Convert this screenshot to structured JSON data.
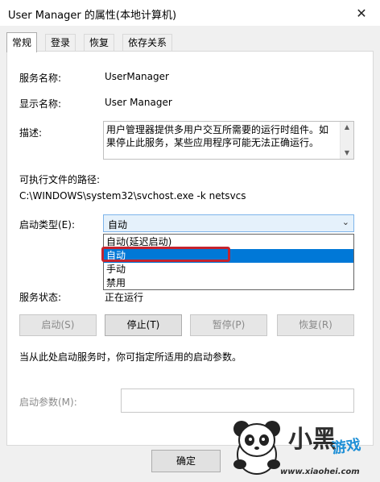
{
  "window": {
    "title": "User Manager 的属性(本地计算机)",
    "close_glyph": "✕"
  },
  "tabs": [
    {
      "label": "常规",
      "active": true
    },
    {
      "label": "登录",
      "active": false
    },
    {
      "label": "恢复",
      "active": false
    },
    {
      "label": "依存关系",
      "active": false
    }
  ],
  "general": {
    "service_name_label": "服务名称:",
    "service_name_value": "UserManager",
    "display_name_label": "显示名称:",
    "display_name_value": "User Manager",
    "description_label": "描述:",
    "description_value": "用户管理器提供多用户交互所需要的运行时组件。如果停止此服务，某些应用程序可能无法正确运行。",
    "exe_path_label": "可执行文件的路径:",
    "exe_path_value": "C:\\WINDOWS\\system32\\svchost.exe -k netsvcs",
    "startup_type_label": "启动类型(E):",
    "startup_type_value": "自动",
    "startup_options": [
      "自动(延迟启动)",
      "自动",
      "手动",
      "禁用"
    ],
    "startup_selected_index": 1,
    "service_status_label": "服务状态:",
    "service_status_value": "正在运行",
    "buttons": {
      "start": "启动(S)",
      "stop": "停止(T)",
      "pause": "暂停(P)",
      "resume": "恢复(R)"
    },
    "hint_text": "当从此处启动服务时，你可指定所适用的启动参数。",
    "start_params_label": "启动参数(M):",
    "start_params_value": ""
  },
  "footer": {
    "ok_label": "确定"
  },
  "watermark": {
    "text": "小黑",
    "text2": "游戏",
    "url": "www.xiaohei.com"
  },
  "colors": {
    "selection": "#0078d7",
    "highlight_border": "#c5232e",
    "watermark_blue": "#1e8fd6"
  }
}
